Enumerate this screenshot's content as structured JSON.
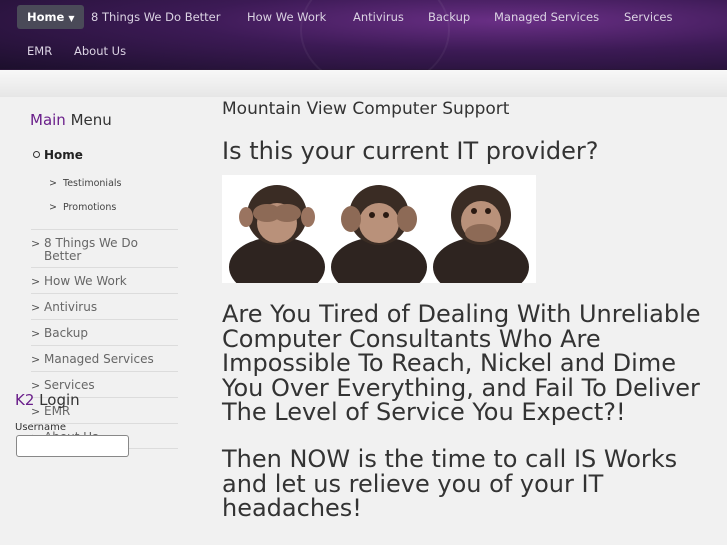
{
  "nav": {
    "items": [
      {
        "label": "Home",
        "active": true
      },
      {
        "label": "8 Things We Do Better"
      },
      {
        "label": "How We Work"
      },
      {
        "label": "Antivirus"
      },
      {
        "label": "Backup"
      },
      {
        "label": "Managed Services"
      },
      {
        "label": "Services"
      },
      {
        "label": "EMR"
      },
      {
        "label": "About Us"
      }
    ]
  },
  "sidebar": {
    "title_accent": "Main",
    "title_rest": "Menu",
    "home_label": "Home",
    "sub_items": [
      "Testimonials",
      "Promotions"
    ],
    "items": [
      "8 Things We Do Better",
      "How We Work",
      "Antivirus",
      "Backup",
      "Managed Services",
      "Services",
      "EMR",
      "About Us"
    ],
    "login_accent": "K2",
    "login_rest": "Login",
    "username_label": "Username"
  },
  "main": {
    "site_title": "Mountain View Computer Support",
    "headline": "Is this your current IT provider?",
    "paragraph1": "Are You Tired of Dealing With Unreliable Computer Consultants Who Are Impossible To Reach, Nickel and Dime You Over Everything, and Fail To Deliver The Level of Service You Expect?!",
    "paragraph2": "Then NOW is the time to call IS Works and let us relieve you of your IT headaches!"
  },
  "colors": {
    "accent": "#6a1f8a",
    "nav_bg": "#3c1a55"
  }
}
